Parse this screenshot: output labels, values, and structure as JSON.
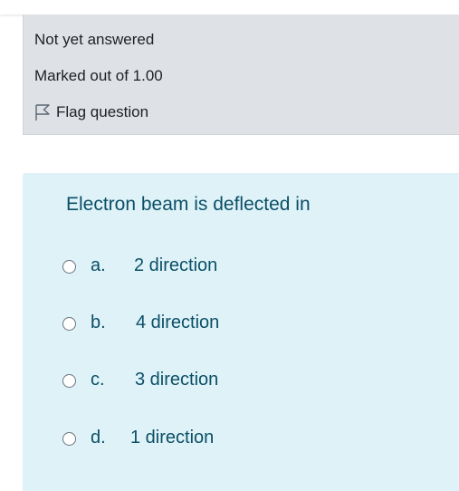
{
  "info": {
    "status": "Not yet answered",
    "marks": "Marked out of 1.00",
    "flag_label": "Flag question",
    "flag_icon": "flag-outline-icon"
  },
  "question": {
    "text": "Electron beam is deflected in",
    "options": [
      {
        "letter": "a.",
        "text": "2 direction"
      },
      {
        "letter": "b.",
        "text": "4 direction"
      },
      {
        "letter": "c.",
        "text": "3 direction"
      },
      {
        "letter": "d.",
        "text": "1 direction"
      }
    ]
  },
  "colors": {
    "info_bg": "#dee2e6",
    "question_bg": "#def2f8",
    "question_text": "#0b4f66",
    "info_text": "#1d2125",
    "radio_border": "#6a737b"
  }
}
